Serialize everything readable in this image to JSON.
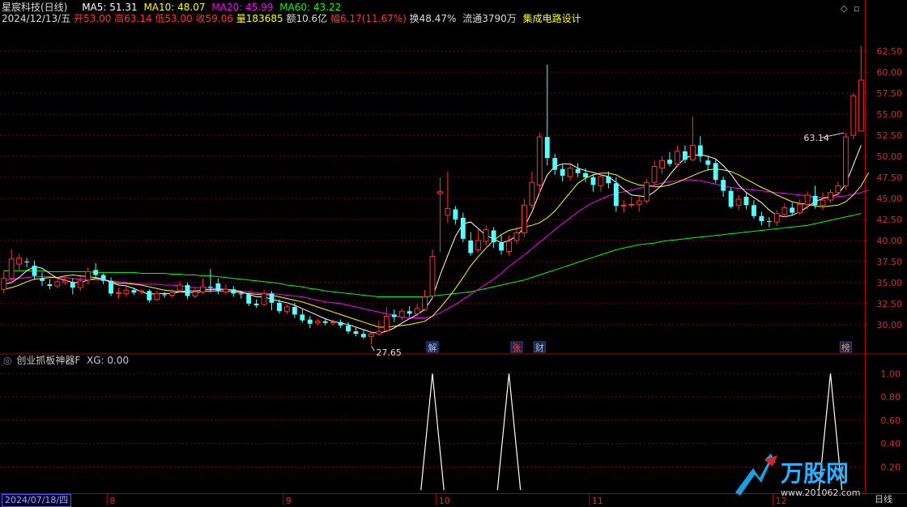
{
  "header": {
    "title": "星宸科技(日线)",
    "ma5": "MA5: 51.31",
    "ma10": "MA10: 48.07",
    "ma20": "MA20: 45.99",
    "ma60": "MA60: 43.22",
    "date": "2024/12/13/五",
    "open": "开53.00",
    "high": "高63.14",
    "low": "低53.00",
    "close": "收59.06",
    "volume": "量183685",
    "amount": "额10.6亿",
    "change": "幅6.17(11.67%)",
    "turnover": "换48.47%",
    "float": "流通3790万",
    "sector": "集成电路设计"
  },
  "indicator": {
    "title": "创业抓板神器F",
    "xg": "XG: 0.00"
  },
  "footer": {
    "cursor_date": "2024/07/18/四",
    "period": "日线"
  },
  "watermark": {
    "brand": "万股网",
    "url": "www.201062.com"
  },
  "colors": {
    "up": "#ff3232",
    "down": "#54ffff",
    "ma5": "#ffffff",
    "ma10": "#ffff00",
    "ma20": "#ff00ff",
    "ma60": "#00ff00",
    "grid": "#8b0000",
    "axis": "#b00000"
  },
  "chart_data": [
    {
      "type": "candlestick",
      "title": "星宸科技(日线)",
      "y_ticks": [
        30.0,
        32.5,
        35.0,
        37.5,
        40.0,
        42.5,
        45.0,
        47.5,
        50.0,
        52.5,
        55.0,
        57.5,
        60.0,
        62.5
      ],
      "ylim": [
        27.0,
        65.5
      ],
      "month_labels": [
        {
          "label": "8",
          "index": 14
        },
        {
          "label": "9",
          "index": 37
        },
        {
          "label": "10",
          "index": 57
        },
        {
          "label": "11",
          "index": 77
        },
        {
          "label": "12",
          "index": 101
        }
      ],
      "annotations": [
        {
          "text": "27.65",
          "index": 48
        },
        {
          "text": "63.14",
          "index": 110
        }
      ],
      "event_markers": [
        {
          "text": "解",
          "index": 56
        },
        {
          "text": "张",
          "index": 67
        },
        {
          "text": "财",
          "index": 70
        },
        {
          "text": "榜",
          "index": 110
        }
      ],
      "candles": [
        [
          34.2,
          35.5,
          36.4,
          33.8
        ],
        [
          35.5,
          37.8,
          38.9,
          35.0
        ],
        [
          37.2,
          37.9,
          38.4,
          36.5
        ],
        [
          37.5,
          37.4,
          37.9,
          36.8
        ],
        [
          37.0,
          35.8,
          37.6,
          35.3
        ],
        [
          35.5,
          35.2,
          36.2,
          34.6
        ],
        [
          34.8,
          34.6,
          35.4,
          34.2
        ],
        [
          34.6,
          35.1,
          35.6,
          34.3
        ],
        [
          35.0,
          35.2,
          35.6,
          34.7
        ],
        [
          35.0,
          34.4,
          35.5,
          33.6
        ],
        [
          34.4,
          35.2,
          35.7,
          34.0
        ],
        [
          35.3,
          36.3,
          36.8,
          34.8
        ],
        [
          36.5,
          35.9,
          37.3,
          35.6
        ],
        [
          35.9,
          35.2,
          36.1,
          34.8
        ],
        [
          35.2,
          33.7,
          35.6,
          33.4
        ],
        [
          33.7,
          33.8,
          34.4,
          33.1
        ],
        [
          33.7,
          34.1,
          34.5,
          33.3
        ],
        [
          34.1,
          33.8,
          34.4,
          33.5
        ],
        [
          33.9,
          34.0,
          34.2,
          33.6
        ],
        [
          34.0,
          32.9,
          34.2,
          32.6
        ],
        [
          33.0,
          33.7,
          34.0,
          32.8
        ],
        [
          33.6,
          33.5,
          33.9,
          33.2
        ],
        [
          33.5,
          33.8,
          34.2,
          33.2
        ],
        [
          34.1,
          34.7,
          35.1,
          33.9
        ],
        [
          34.7,
          33.4,
          35.0,
          33.0
        ],
        [
          33.4,
          33.9,
          34.4,
          33.1
        ],
        [
          33.9,
          34.5,
          35.5,
          33.6
        ],
        [
          34.5,
          34.4,
          36.6,
          33.8
        ],
        [
          34.9,
          34.0,
          35.5,
          33.6
        ],
        [
          33.9,
          34.2,
          34.8,
          33.6
        ],
        [
          34.2,
          33.7,
          34.6,
          33.3
        ],
        [
          33.7,
          33.6,
          34.0,
          33.1
        ],
        [
          33.6,
          32.5,
          33.8,
          32.2
        ],
        [
          32.5,
          32.3,
          33.0,
          32.0
        ],
        [
          32.4,
          33.7,
          34.1,
          32.2
        ],
        [
          33.7,
          32.6,
          34.0,
          31.7
        ],
        [
          32.6,
          31.6,
          33.0,
          31.3
        ],
        [
          31.6,
          32.1,
          32.4,
          31.3
        ],
        [
          32.1,
          31.2,
          32.6,
          30.8
        ],
        [
          31.2,
          30.5,
          31.8,
          30.2
        ],
        [
          30.6,
          30.1,
          31.0,
          29.6
        ],
        [
          30.2,
          30.4,
          30.7,
          29.9
        ],
        [
          30.4,
          30.2,
          30.8,
          29.9
        ],
        [
          30.3,
          30.3,
          30.6,
          29.9
        ],
        [
          30.3,
          29.9,
          30.6,
          29.6
        ],
        [
          29.9,
          29.2,
          30.3,
          28.9
        ],
        [
          29.2,
          28.9,
          29.6,
          28.6
        ],
        [
          28.9,
          28.5,
          29.4,
          28.3
        ],
        [
          28.6,
          28.9,
          29.2,
          27.65
        ],
        [
          28.9,
          29.2,
          30.5,
          28.7
        ],
        [
          29.3,
          31.0,
          32.1,
          29.1
        ],
        [
          31.2,
          30.9,
          31.8,
          30.3
        ],
        [
          30.9,
          31.6,
          31.9,
          30.5
        ],
        [
          31.6,
          31.3,
          32.2,
          30.9
        ],
        [
          31.3,
          31.9,
          32.5,
          31.0
        ],
        [
          31.8,
          33.3,
          34.1,
          31.6
        ],
        [
          33.4,
          38.1,
          38.9,
          33.2
        ],
        [
          45.6,
          45.8,
          47.5,
          38.6
        ],
        [
          43.0,
          43.8,
          48.2,
          42.1
        ],
        [
          43.7,
          42.5,
          44.1,
          41.9
        ],
        [
          42.7,
          40.2,
          43.3,
          39.8
        ],
        [
          40.0,
          38.5,
          41.0,
          38.2
        ],
        [
          38.9,
          40.0,
          41.3,
          38.6
        ],
        [
          39.9,
          41.3,
          41.8,
          39.4
        ],
        [
          41.2,
          39.8,
          41.6,
          39.1
        ],
        [
          39.7,
          38.8,
          40.6,
          38.3
        ],
        [
          38.7,
          39.9,
          40.6,
          38.2
        ],
        [
          40.0,
          40.9,
          41.6,
          39.6
        ],
        [
          40.9,
          44.2,
          44.9,
          40.4
        ],
        [
          44.2,
          46.9,
          48.2,
          43.8
        ],
        [
          46.6,
          52.3,
          52.8,
          45.6
        ],
        [
          52.3,
          49.8,
          60.9,
          48.9
        ],
        [
          49.8,
          48.4,
          50.3,
          47.8
        ],
        [
          48.5,
          47.7,
          49.0,
          47.0
        ],
        [
          47.6,
          48.6,
          49.0,
          47.1
        ],
        [
          48.5,
          48.0,
          49.2,
          47.5
        ],
        [
          48.0,
          47.5,
          48.6,
          46.9
        ],
        [
          47.5,
          46.6,
          47.9,
          45.8
        ],
        [
          46.5,
          47.6,
          48.0,
          45.8
        ],
        [
          47.6,
          46.8,
          48.2,
          46.2
        ],
        [
          46.8,
          44.1,
          47.5,
          43.4
        ],
        [
          44.2,
          44.2,
          44.8,
          43.3
        ],
        [
          44.2,
          44.3,
          45.2,
          43.9
        ],
        [
          44.3,
          44.7,
          45.5,
          43.4
        ],
        [
          44.7,
          46.9,
          47.3,
          44.4
        ],
        [
          46.9,
          48.8,
          49.5,
          46.3
        ],
        [
          48.6,
          49.5,
          50.0,
          47.9
        ],
        [
          49.6,
          49.1,
          50.5,
          48.8
        ],
        [
          49.1,
          50.6,
          51.3,
          48.7
        ],
        [
          50.6,
          49.6,
          51.3,
          49.2
        ],
        [
          49.6,
          51.3,
          54.7,
          49.4
        ],
        [
          51.3,
          50.0,
          52.4,
          49.3
        ],
        [
          49.5,
          49.0,
          50.1,
          48.3
        ],
        [
          49.2,
          47.2,
          49.6,
          46.8
        ],
        [
          47.2,
          45.9,
          47.6,
          45.2
        ],
        [
          45.9,
          44.0,
          46.3,
          43.8
        ],
        [
          44.2,
          44.9,
          45.4,
          43.6
        ],
        [
          45.2,
          44.2,
          45.8,
          43.7
        ],
        [
          44.2,
          42.9,
          44.8,
          42.6
        ],
        [
          42.9,
          42.3,
          43.4,
          41.8
        ],
        [
          42.3,
          42.2,
          42.8,
          41.6
        ],
        [
          42.2,
          43.2,
          43.6,
          41.7
        ],
        [
          43.1,
          43.9,
          44.4,
          42.8
        ],
        [
          43.9,
          43.3,
          44.5,
          43.0
        ],
        [
          43.3,
          44.3,
          44.9,
          43.0
        ],
        [
          44.3,
          45.4,
          45.8,
          43.7
        ],
        [
          45.3,
          44.2,
          46.5,
          43.8
        ],
        [
          44.2,
          44.8,
          45.7,
          43.6
        ],
        [
          44.8,
          45.7,
          46.1,
          44.4
        ],
        [
          45.7,
          46.5,
          47.0,
          45.2
        ],
        [
          46.5,
          52.3,
          52.8,
          46.0
        ],
        [
          52.5,
          57.2,
          57.5,
          52.0
        ],
        [
          53.0,
          59.06,
          63.14,
          53.0
        ]
      ],
      "ma5": [
        34.8,
        35.0,
        35.6,
        36.4,
        36.9,
        36.7,
        36.1,
        35.5,
        35.3,
        35.0,
        35.0,
        35.3,
        35.5,
        35.4,
        35.0,
        34.7,
        34.6,
        34.3,
        33.9,
        33.6,
        33.7,
        33.7,
        33.7,
        33.9,
        34.0,
        34.0,
        34.1,
        34.2,
        34.2,
        34.2,
        34.1,
        33.9,
        33.6,
        33.3,
        33.3,
        33.0,
        32.8,
        32.6,
        32.3,
        31.9,
        31.5,
        31.1,
        30.7,
        30.4,
        30.2,
        30.0,
        29.7,
        29.4,
        29.1,
        29.0,
        29.2,
        29.6,
        30.2,
        30.7,
        31.2,
        31.8,
        33.2,
        35.9,
        38.2,
        40.5,
        42.0,
        42.2,
        41.4,
        40.6,
        40.2,
        39.7,
        40.0,
        40.5,
        41.6,
        43.4,
        45.7,
        47.8,
        48.8,
        49.1,
        49.1,
        48.6,
        48.3,
        48.1,
        47.8,
        47.6,
        46.9,
        46.1,
        45.4,
        45.3,
        45.2,
        45.8,
        46.6,
        47.8,
        48.9,
        49.8,
        50.1,
        50.2,
        50.0,
        49.7,
        48.9,
        47.9,
        46.6,
        45.7,
        45.1,
        44.5,
        43.6,
        43.0,
        42.8,
        43.0,
        43.4,
        44.0,
        44.6,
        45.0,
        45.2,
        45.5,
        46.7,
        49.0,
        51.31
      ],
      "ma10": [
        34.2,
        34.4,
        34.7,
        35.1,
        35.4,
        35.5,
        35.6,
        35.6,
        35.8,
        35.9,
        35.8,
        35.7,
        35.6,
        35.4,
        35.1,
        34.9,
        34.9,
        34.8,
        34.7,
        34.5,
        34.3,
        34.1,
        34.0,
        33.9,
        33.8,
        33.8,
        33.9,
        34.0,
        34.0,
        34.0,
        33.9,
        33.8,
        33.7,
        33.6,
        33.6,
        33.5,
        33.3,
        33.1,
        32.9,
        32.7,
        32.4,
        32.1,
        31.8,
        31.5,
        31.2,
        30.9,
        30.6,
        30.3,
        30.0,
        29.7,
        29.7,
        29.8,
        29.9,
        30.0,
        30.2,
        30.4,
        31.0,
        32.0,
        33.1,
        34.3,
        35.6,
        37.0,
        38.1,
        39.1,
        40.0,
        40.7,
        41.2,
        41.4,
        41.6,
        41.8,
        42.1,
        42.7,
        43.5,
        44.6,
        45.7,
        46.8,
        47.4,
        47.8,
        48.0,
        48.0,
        47.8,
        47.3,
        46.9,
        46.6,
        46.5,
        46.4,
        46.4,
        46.6,
        46.9,
        47.3,
        47.7,
        48.1,
        48.4,
        48.5,
        48.4,
        48.2,
        47.8,
        47.3,
        46.8,
        46.3,
        45.9,
        45.4,
        45.0,
        44.6,
        44.4,
        44.3,
        44.1,
        44.0,
        44.1,
        44.2,
        44.6,
        45.4,
        46.5,
        48.07
      ],
      "ma20": [
        35.2,
        35.4,
        35.5,
        35.6,
        35.7,
        35.7,
        35.7,
        35.6,
        35.6,
        35.5,
        35.4,
        35.4,
        35.3,
        35.3,
        35.2,
        35.1,
        35.0,
        34.9,
        34.8,
        34.8,
        34.8,
        34.7,
        34.7,
        34.6,
        34.5,
        34.4,
        34.4,
        34.3,
        34.3,
        34.2,
        34.1,
        34.0,
        33.9,
        33.8,
        33.7,
        33.7,
        33.6,
        33.5,
        33.4,
        33.3,
        33.1,
        32.9,
        32.7,
        32.6,
        32.5,
        32.3,
        32.1,
        31.9,
        31.7,
        31.5,
        31.3,
        31.1,
        30.9,
        30.8,
        30.8,
        30.8,
        31.0,
        31.4,
        31.9,
        32.4,
        33.0,
        33.6,
        34.2,
        34.8,
        35.4,
        36.1,
        36.9,
        37.6,
        38.3,
        39.0,
        39.8,
        40.5,
        41.3,
        42.0,
        42.7,
        43.4,
        44.0,
        44.5,
        44.9,
        45.3,
        45.6,
        45.8,
        46.0,
        46.2,
        46.4,
        46.6,
        46.8,
        47.0,
        47.1,
        47.2,
        47.2,
        47.1,
        46.9,
        46.7,
        46.5,
        46.3,
        46.2,
        46.1,
        46.0,
        45.9,
        45.8,
        45.7,
        45.6,
        45.5,
        45.4,
        45.3,
        45.2,
        45.1,
        45.1,
        45.2,
        45.3,
        45.5,
        45.7,
        45.99
      ],
      "ma60": [
        36.4,
        36.4,
        36.4,
        36.4,
        36.4,
        36.4,
        36.3,
        36.3,
        36.3,
        36.3,
        36.3,
        36.3,
        36.2,
        36.2,
        36.2,
        36.2,
        36.2,
        36.2,
        36.1,
        36.1,
        36.1,
        36.1,
        36.0,
        36.0,
        35.9,
        35.9,
        35.8,
        35.8,
        35.7,
        35.6,
        35.5,
        35.4,
        35.3,
        35.2,
        35.1,
        35.0,
        34.9,
        34.7,
        34.6,
        34.5,
        34.3,
        34.2,
        34.0,
        33.9,
        33.8,
        33.7,
        33.6,
        33.5,
        33.4,
        33.3,
        33.3,
        33.3,
        33.3,
        33.3,
        33.3,
        33.3,
        33.4,
        33.5,
        33.6,
        33.7,
        33.8,
        33.9,
        34.1,
        34.3,
        34.5,
        34.7,
        34.9,
        35.1,
        35.3,
        35.6,
        35.9,
        36.2,
        36.5,
        36.8,
        37.1,
        37.4,
        37.7,
        38.0,
        38.3,
        38.6,
        38.9,
        39.1,
        39.3,
        39.5,
        39.6,
        39.7,
        39.9,
        40.0,
        40.1,
        40.2,
        40.3,
        40.4,
        40.5,
        40.6,
        40.7,
        40.8,
        40.9,
        41.0,
        41.1,
        41.2,
        41.3,
        41.4,
        41.5,
        41.6,
        41.7,
        41.8,
        42.0,
        42.2,
        42.4,
        42.6,
        42.8,
        43.0,
        43.22
      ]
    },
    {
      "type": "line",
      "title": "创业抓板神器F",
      "y_ticks": [
        0.2,
        0.4,
        0.6,
        0.8,
        1.0
      ],
      "ylim": [
        -0.02,
        1.12
      ],
      "signals": [
        {
          "name": "XG",
          "index": 56,
          "value": 1.0
        },
        {
          "name": "XG",
          "index": 66,
          "value": 1.0
        },
        {
          "name": "XG",
          "index": 108,
          "value": 1.0
        }
      ]
    }
  ]
}
